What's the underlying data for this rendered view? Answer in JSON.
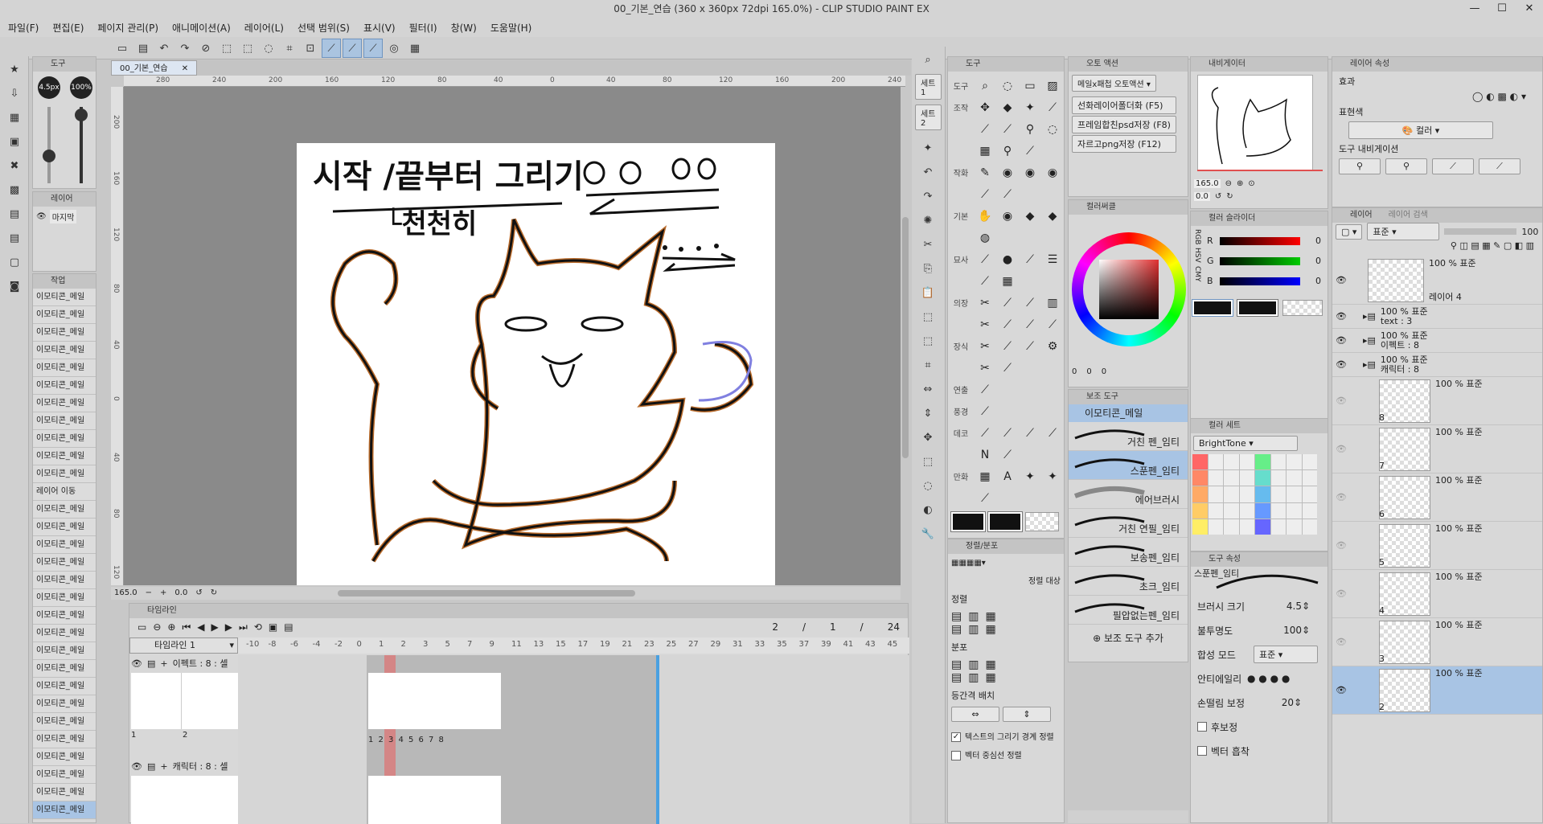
{
  "window": {
    "title": "00_기본_연습 (360 x 360px 72dpi 165.0%)  - CLIP STUDIO PAINT EX",
    "minimize": "—",
    "maximize": "☐",
    "close": "✕"
  },
  "menu": [
    "파일(F)",
    "편집(E)",
    "페이지 관리(P)",
    "애니메이션(A)",
    "레이어(L)",
    "선택 범위(S)",
    "표시(V)",
    "필터(I)",
    "창(W)",
    "도움말(H)"
  ],
  "document_tab": "00_기본_연습",
  "left": {
    "tool_panel_title": "도구",
    "brush_size": "4.5px",
    "opacity": "100%",
    "layer_panel_title": "레이어",
    "layer_item": "마지막",
    "action_panel_title": "작업",
    "action_items": [
      "이모티콘_메일",
      "이모티콘_메일",
      "이모티콘_메일",
      "이모티콘_메일",
      "이모티콘_메일",
      "이모티콘_메일",
      "이모티콘_메일",
      "이모티콘_메일",
      "이모티콘_메일",
      "이모티콘_메일",
      "이모티콘_메일",
      "레이어 이동",
      "이모티콘_메일",
      "이모티콘_메일",
      "이모티콘_메일",
      "이모티콘_메일",
      "이모티콘_메일",
      "이모티콘_메일",
      "이모티콘_메일",
      "이모티콘_메일",
      "이모티콘_메일",
      "이모티콘_메일",
      "이모티콘_메일",
      "이모티콘_메일",
      "이모티콘_메일",
      "이모티콘_메일",
      "이모티콘_메일",
      "이모티콘_메일",
      "이모티콘_메일",
      "이모티콘_메일"
    ]
  },
  "ruler_h": [
    "280",
    "240",
    "200",
    "160",
    "120",
    "80",
    "40",
    "0",
    "40",
    "80",
    "120",
    "160",
    "200",
    "240"
  ],
  "ruler_v": [
    "200",
    "160",
    "120",
    "80",
    "40",
    "0",
    "40",
    "80",
    "120"
  ],
  "canvas": {
    "text_line1": "시작 /끝부터 그리기",
    "text_line2": "└천천히",
    "zoom": "165.0",
    "angle": "0.0"
  },
  "timeline": {
    "title": "타임라인",
    "select": "타임라인 1",
    "counter": [
      "2",
      "/",
      "1",
      "/",
      "24"
    ],
    "frames": [
      "-10",
      "-8",
      "-6",
      "-4",
      "-2",
      "0",
      "1",
      "2",
      "3",
      "5",
      "7",
      "9",
      "11",
      "13",
      "15",
      "17",
      "19",
      "21",
      "23",
      "25",
      "27",
      "29",
      "31",
      "33",
      "35",
      "37",
      "39",
      "41",
      "43",
      "45"
    ],
    "track1": "이펙트 : 8 : 셀",
    "track2": "캐릭터 : 8 : 셀",
    "track1_cells": [
      "1",
      "2"
    ],
    "cell_nums": [
      "1",
      "2",
      "3",
      "4",
      "5",
      "6",
      "7",
      "8"
    ]
  },
  "tools": {
    "panel_title": "도구",
    "set1": "세트1",
    "set2": "세트2",
    "categories": [
      "도구",
      "조작",
      "",
      "",
      "작화",
      "",
      "기본",
      "",
      "묘사",
      "",
      "의장",
      "",
      "장식",
      "",
      "연출",
      "풍경",
      "데코",
      "",
      "만화",
      ""
    ]
  },
  "align": {
    "panel_title": "정렬/분포",
    "target_label": "정렬 대상",
    "align_label": "정렬",
    "distribute_label": "분포",
    "equal_label": "등간격 배치",
    "check1": "텍스트의 그리기 경계 정렬",
    "check2": "벡터 중심선 정렬"
  },
  "auto_action": {
    "panel_title": "오토 액션",
    "select": "메일x패첩 오토액션",
    "items": [
      "선화레이어폴더화 (F5)",
      "프레임합친psd저장 (F8)",
      "자르고png저장 (F12)"
    ]
  },
  "color_wheel": {
    "panel_title": "컬러써클",
    "readout": [
      "0",
      "0",
      "0"
    ]
  },
  "sub_tool": {
    "panel_title": "보조 도구",
    "group": "이모티콘_메일",
    "items": [
      "거친 펜_임티",
      "스푼펜_임티",
      "에어브러시",
      "거친 연필_임티",
      "보송펜_임티",
      "초크_임티",
      "필압없는펜_임티"
    ],
    "add_label": "보조 도구 추가"
  },
  "navigator": {
    "panel_title": "내비게이터",
    "zoom": "165.0",
    "angle": "0.0"
  },
  "color_slider": {
    "panel_title": "컬러 슬라이더",
    "labels": [
      "R",
      "G",
      "B"
    ],
    "values": [
      "0",
      "0",
      "0"
    ],
    "mode_tabs": [
      "RGB",
      "HSV",
      "CMY"
    ]
  },
  "color_set": {
    "panel_title": "컬러 세트",
    "select": "BrightTone"
  },
  "tool_property": {
    "panel_title": "도구 속성",
    "current": "스푼펜_임티",
    "brush_size_label": "브러시 크기",
    "brush_size_value": "4.5",
    "opacity_label": "불투명도",
    "opacity_value": "100",
    "blend_label": "합성 모드",
    "blend_value": "표준",
    "aa_label": "안티에일리",
    "stab_label": "손떨림 보정",
    "stab_value": "20",
    "post_label": "후보정",
    "vector_label": "벡터 흡착"
  },
  "layer_property": {
    "panel_title": "레이어 속성",
    "effect_label": "효과",
    "expression_label": "표현색",
    "expression_value": "컬러",
    "tool_nav_label": "도구 내비게이션"
  },
  "layers": {
    "panel_title": "레이어",
    "tab2": "레이어 검색",
    "blend": "표준",
    "opacity": "100",
    "rows": [
      {
        "mode": "100 % 표준",
        "name": "레이어 4"
      },
      {
        "mode": "100 % 표준",
        "name": "text : 3"
      },
      {
        "mode": "100 % 표준",
        "name": "이펙트 : 8"
      },
      {
        "mode": "100 % 표준",
        "name": "캐릭터 : 8"
      }
    ],
    "cels": [
      {
        "mode": "100 % 표준",
        "name": "8"
      },
      {
        "mode": "100 % 표준",
        "name": "7"
      },
      {
        "mode": "100 % 표준",
        "name": "6"
      },
      {
        "mode": "100 % 표준",
        "name": "5"
      },
      {
        "mode": "100 % 표준",
        "name": "4"
      },
      {
        "mode": "100 % 표준",
        "name": "3"
      },
      {
        "mode": "100 % 표준",
        "name": "2"
      }
    ]
  },
  "colors": {
    "accent": "#a8c4e4",
    "playhead": "#e07070",
    "brush_outline": "#b86a2a",
    "stroke_purple": "#8080e0"
  }
}
